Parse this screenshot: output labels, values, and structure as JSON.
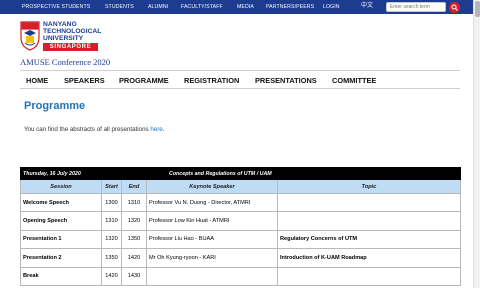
{
  "topbar": {
    "links": [
      "PROSPECTIVE STUDENTS",
      "STUDENTS",
      "ALUMNI",
      "FACULTY/STAFF",
      "MEDIA",
      "PARTNERS/PEERS",
      "LOGIN"
    ],
    "lang": "中文",
    "search_placeholder": "Enter search term"
  },
  "logo": {
    "line1": "NANYANG",
    "line2": "TECHNOLOGICAL",
    "line3": "UNIVERSITY",
    "line4": "SINGAPORE"
  },
  "conference_title": "AMUSE Conference 2020",
  "nav": [
    "HOME",
    "SPEAKERS",
    "PROGRAMME",
    "REGISTRATION",
    "PRESENTATIONS",
    "COMMITTEE"
  ],
  "page_title": "Programme",
  "intro": {
    "text": "You can find the abstracts of all presentations ",
    "link": "here",
    "end": "."
  },
  "schedule": {
    "date": "Thursday, 16 July 2020",
    "theme": "Concepts and Regulations of UTM / UAM",
    "headers": [
      "Session",
      "Start",
      "End",
      "Keynote Speaker",
      "Topic"
    ],
    "rows": [
      [
        "Welcome Speech",
        "1300",
        "1310",
        "Professor Vu N. Duong - Director, ATMRI",
        ""
      ],
      [
        "Opening Speech",
        "1310",
        "1320",
        "Professor Low Kin Huat - ATMRI",
        ""
      ],
      [
        "Presentation 1",
        "1320",
        "1350",
        "Professor Liu Hao - BUAA",
        "Regulatory Concerns of UTM"
      ],
      [
        "Presentation 2",
        "1350",
        "1420",
        "Mr Oh Kyung-ryoon - KARI",
        "Introduction of K-UAM Roadmap"
      ],
      [
        "Break",
        "1420",
        "1430",
        "",
        ""
      ]
    ]
  },
  "colors": {
    "brand_blue": "#1d3b8f",
    "brand_red": "#d51f2a",
    "title_blue": "#1f73b7",
    "table_header": "#bfdcf4"
  }
}
